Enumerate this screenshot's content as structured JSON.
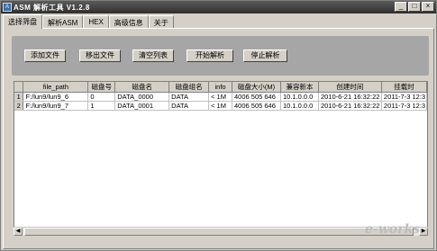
{
  "window": {
    "title": "ASM 解析工具  V1.2.8",
    "icon_label": "ASM",
    "controls": [
      "minimize-icon",
      "maximize-icon",
      "close-icon"
    ]
  },
  "tabs": [
    {
      "label": "选择筛盘",
      "active": true
    },
    {
      "label": "解析ASM",
      "active": false
    },
    {
      "label": "HEX",
      "active": false
    },
    {
      "label": "高级信息",
      "active": false
    },
    {
      "label": "关于",
      "active": false
    }
  ],
  "toolbar": {
    "add_file": "添加文件",
    "remove_file": "移出文件",
    "clear_list": "清空列表",
    "start_parse": "开始解析",
    "stop_parse": "停止解析"
  },
  "table": {
    "columns": [
      "",
      "file_path",
      "磁盘号",
      "磁盘名",
      "磁盘组名",
      "info",
      "磁盘大小(M)",
      "兼容新本",
      "创建时间",
      "挂载时"
    ],
    "rows": [
      {
        "index": "1",
        "file_path": "F:/lun9/lun9_6",
        "disk_no": "0",
        "disk_name": "DATA_0000",
        "group_name": "DATA",
        "info": "< 1M",
        "size": "4006 505 646",
        "compat": "10.1.0.0.0",
        "created": "2010-6-21  16:32:22",
        "mounted": "2011-7-3  12:3"
      },
      {
        "index": "2",
        "file_path": "F:/lun9/lun9_7",
        "disk_no": "1",
        "disk_name": "DATA_0001",
        "group_name": "DATA",
        "info": "< 1M",
        "size": "4006 505 646",
        "compat": "10.1.0.0.0",
        "created": "2010-6-21  16:32:22",
        "mounted": "2011-7-3  12:3"
      }
    ]
  },
  "watermark": "e-works"
}
